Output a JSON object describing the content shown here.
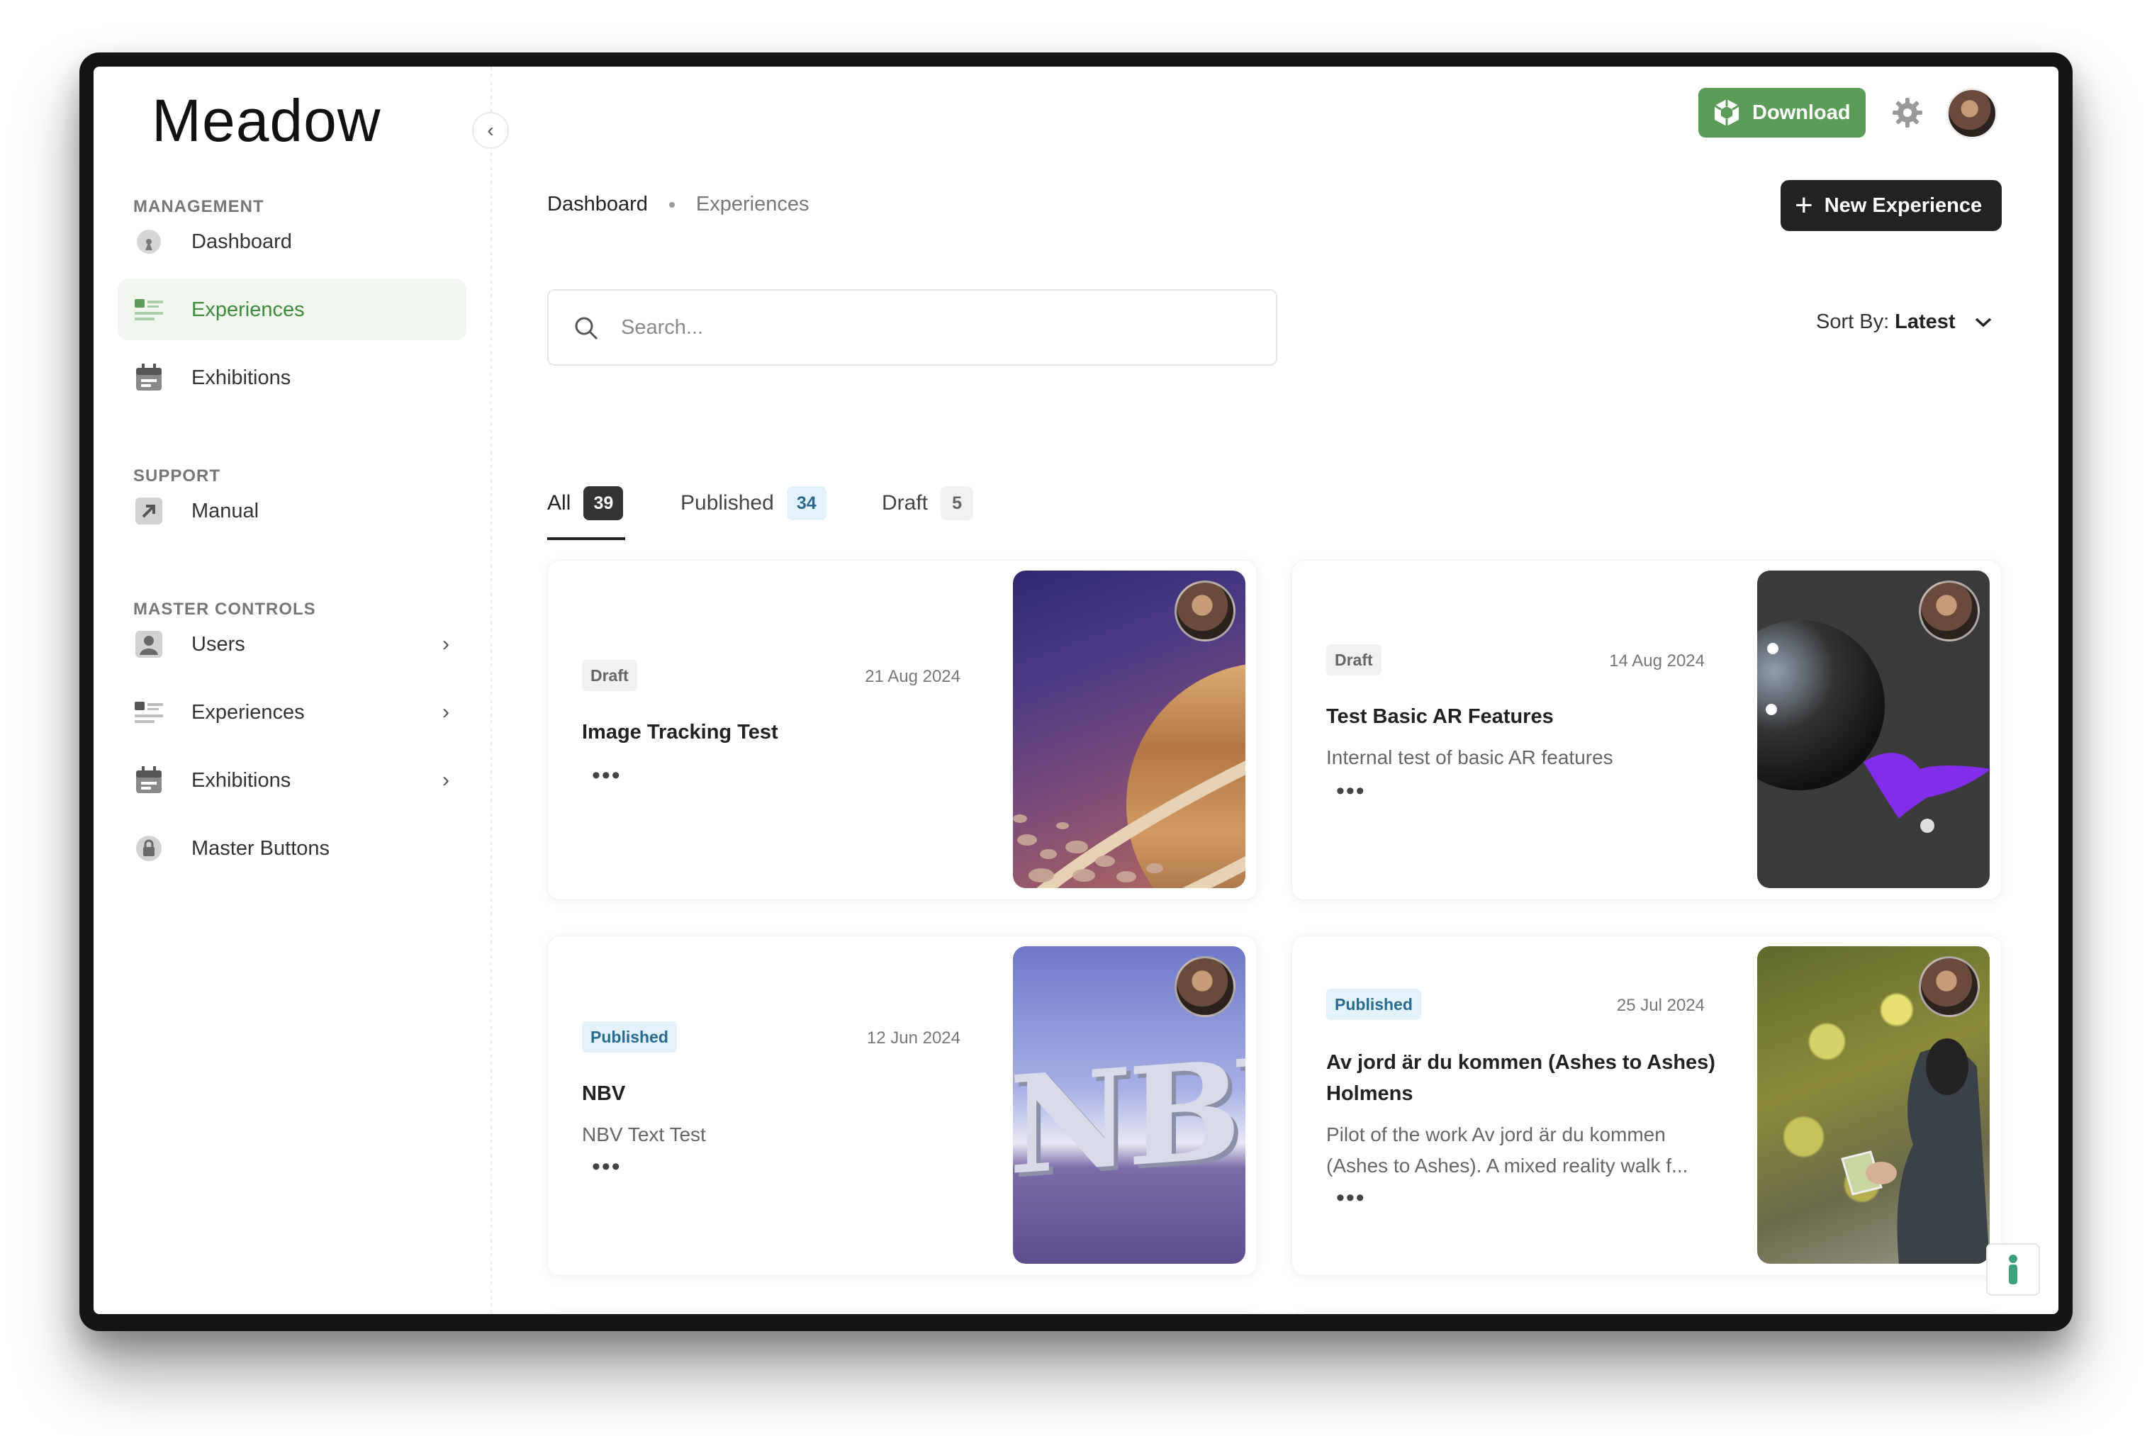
{
  "app": {
    "logo": "Meadow"
  },
  "sidebar": {
    "sections": {
      "management": "MANAGEMENT",
      "support": "SUPPORT",
      "master_controls": "MASTER CONTROLS"
    },
    "items": {
      "dashboard": "Dashboard",
      "experiences": "Experiences",
      "exhibitions": "Exhibitions",
      "manual": "Manual",
      "users": "Users",
      "master_experiences": "Experiences",
      "master_exhibitions": "Exhibitions",
      "master_buttons": "Master Buttons"
    },
    "collapse_glyph": "‹",
    "chevron_glyph": "›"
  },
  "header": {
    "download_label": "Download"
  },
  "breadcrumb": {
    "item1": "Dashboard",
    "item2": "Experiences"
  },
  "actions": {
    "new_experience": "New Experience",
    "plus_glyph": "+"
  },
  "search": {
    "placeholder": "Search..."
  },
  "sort": {
    "label": "Sort By:",
    "value": "Latest"
  },
  "tabs": {
    "all": {
      "label": "All",
      "count": "39"
    },
    "published": {
      "label": "Published",
      "count": "34"
    },
    "draft": {
      "label": "Draft",
      "count": "5"
    }
  },
  "cards": [
    {
      "status": "Draft",
      "date": "21 Aug 2024",
      "title": "Image Tracking Test",
      "description": "",
      "menu": "•••"
    },
    {
      "status": "Draft",
      "date": "14 Aug 2024",
      "title": "Test Basic AR Features",
      "description": "Internal test of basic AR features",
      "menu": "•••"
    },
    {
      "status": "Published",
      "date": "12 Jun 2024",
      "title": "NBV",
      "description": "NBV Text Test",
      "menu": "•••"
    },
    {
      "status": "Published",
      "date": "25 Jul 2024",
      "title": "Av jord är du kommen (Ashes to Ashes) Holmens",
      "description": "Pilot of the work Av jord är du kommen (Ashes to Ashes). A mixed reality walk f...",
      "menu": "•••"
    }
  ],
  "thumb_text": {
    "nbv": "NBV"
  },
  "colors": {
    "accent_green": "#5b9c59",
    "active_nav_bg": "#f1f6ef",
    "dark_button": "#222222",
    "published_badge": "#e3f2fb"
  }
}
